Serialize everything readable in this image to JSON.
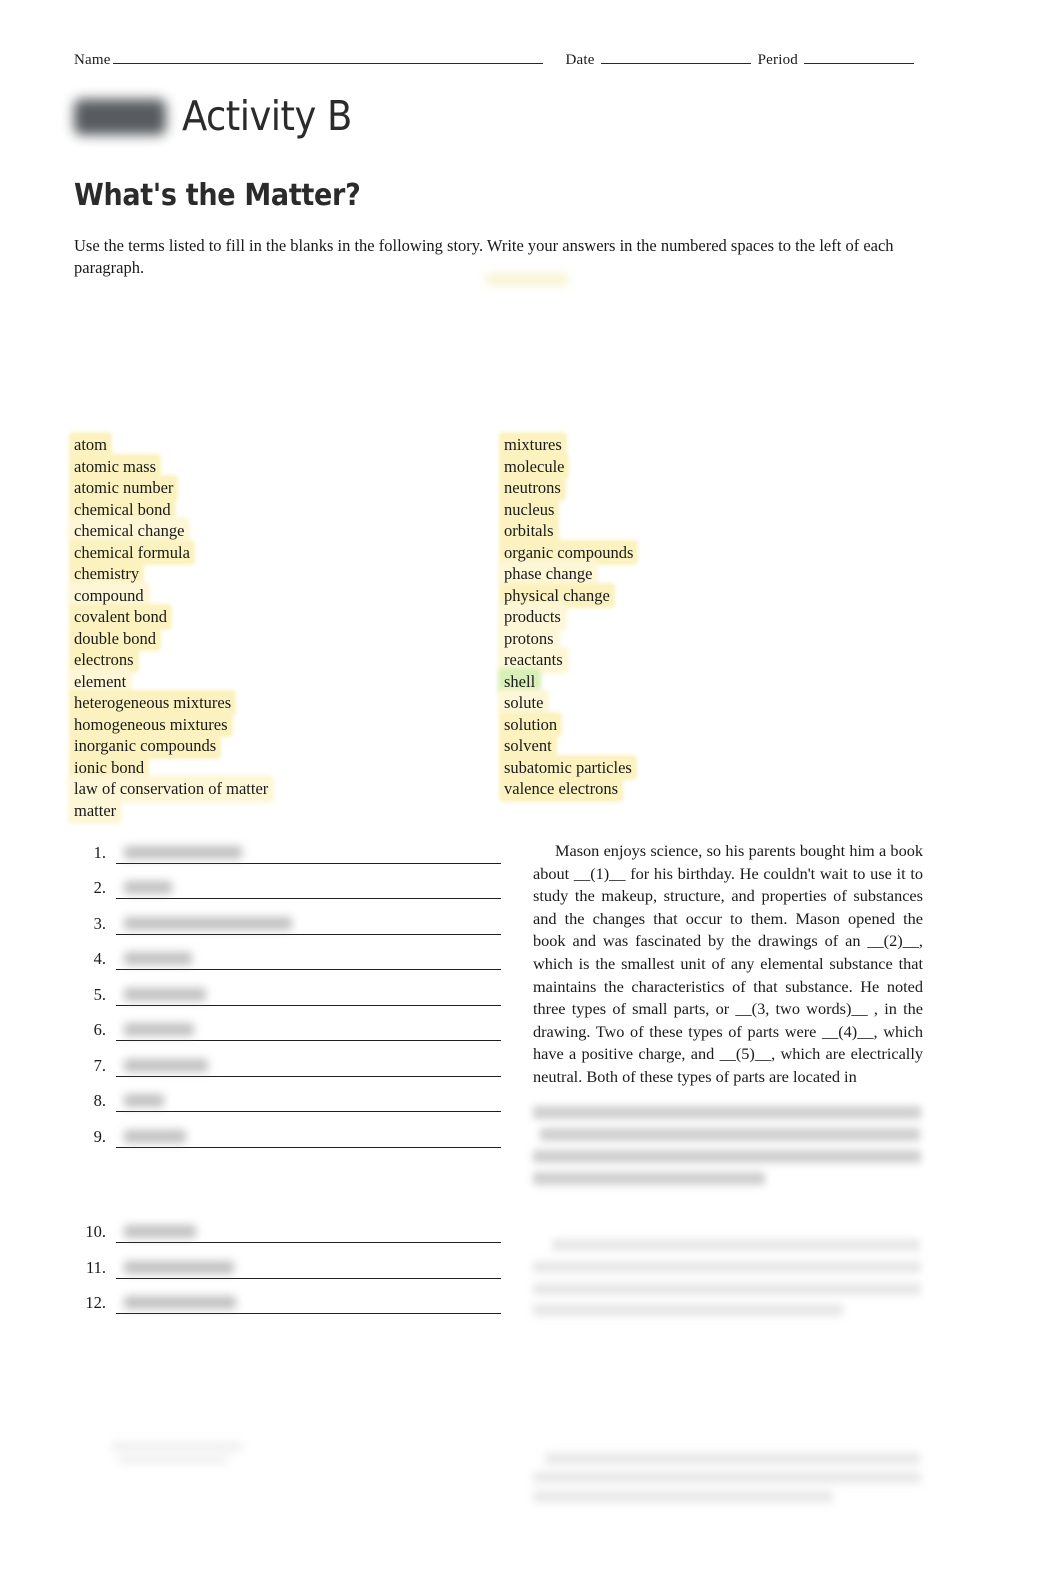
{
  "header": {
    "name_label": "Name",
    "date_label": "Date",
    "period_label": "Period"
  },
  "title": {
    "redacted_label": "",
    "activity": "Activity B",
    "worksheet": "What's the Matter?"
  },
  "instructions": {
    "text": "Use the terms listed to fill in the blanks in the following story. Write your answers in the numbered spaces to the left of each paragraph."
  },
  "word_bank": {
    "left_column": [
      {
        "term": "atom",
        "highlight": "yellow"
      },
      {
        "term": "atomic mass",
        "highlight": "yellow"
      },
      {
        "term": "atomic number",
        "highlight": "yellow"
      },
      {
        "term": "chemical bond",
        "highlight": "yellow"
      },
      {
        "term": "chemical change",
        "highlight": "yellow-soft"
      },
      {
        "term": "chemical formula",
        "highlight": "yellow"
      },
      {
        "term": "chemistry",
        "highlight": "yellow"
      },
      {
        "term": "compound",
        "highlight": "yellow-soft"
      },
      {
        "term": "covalent bond",
        "highlight": "yellow"
      },
      {
        "term": "double bond",
        "highlight": "yellow"
      },
      {
        "term": "electrons",
        "highlight": "yellow"
      },
      {
        "term": "element",
        "highlight": "yellow-soft"
      },
      {
        "term": "heterogeneous mixtures",
        "highlight": "yellow"
      },
      {
        "term": "homogeneous mixtures",
        "highlight": "yellow"
      },
      {
        "term": "inorganic compounds",
        "highlight": "yellow"
      },
      {
        "term": "ionic bond",
        "highlight": "yellow"
      },
      {
        "term": "law of conservation of matter",
        "highlight": "yellow-soft"
      },
      {
        "term": "matter",
        "highlight": "yellow-soft"
      }
    ],
    "right_column": [
      {
        "term": "mixtures",
        "highlight": "yellow"
      },
      {
        "term": "molecule",
        "highlight": "yellow"
      },
      {
        "term": "neutrons",
        "highlight": "yellow"
      },
      {
        "term": "nucleus",
        "highlight": "yellow"
      },
      {
        "term": "orbitals",
        "highlight": "yellow"
      },
      {
        "term": "organic compounds",
        "highlight": "yellow"
      },
      {
        "term": "phase change",
        "highlight": "yellow-soft"
      },
      {
        "term": "physical change",
        "highlight": "yellow"
      },
      {
        "term": "products",
        "highlight": "yellow-soft"
      },
      {
        "term": "protons",
        "highlight": "yellow-soft"
      },
      {
        "term": "reactants",
        "highlight": "yellow-soft"
      },
      {
        "term": "shell",
        "highlight": "green"
      },
      {
        "term": "solute",
        "highlight": "yellow-soft"
      },
      {
        "term": "solution",
        "highlight": "yellow"
      },
      {
        "term": "solvent",
        "highlight": "yellow"
      },
      {
        "term": "subatomic particles",
        "highlight": "yellow"
      },
      {
        "term": "valence electrons",
        "highlight": "yellow"
      }
    ]
  },
  "answers": {
    "items": [
      {
        "number": "1.",
        "answer": "",
        "answer_width": 118,
        "redacted": true
      },
      {
        "number": "2.",
        "answer": "",
        "answer_width": 48,
        "redacted": true
      },
      {
        "number": "3.",
        "answer": "",
        "answer_width": 168,
        "redacted": true
      },
      {
        "number": "4.",
        "answer": "",
        "answer_width": 68,
        "redacted": true
      },
      {
        "number": "5.",
        "answer": "",
        "answer_width": 82,
        "redacted": true
      },
      {
        "number": "6.",
        "answer": "",
        "answer_width": 70,
        "redacted": true
      },
      {
        "number": "7.",
        "answer": "",
        "answer_width": 84,
        "redacted": true
      },
      {
        "number": "8.",
        "answer": "",
        "answer_width": 40,
        "redacted": true
      },
      {
        "number": "9.",
        "answer": "",
        "answer_width": 62,
        "redacted": true
      },
      {
        "number": "10.",
        "answer": "",
        "answer_width": 72,
        "redacted": true
      },
      {
        "number": "11.",
        "answer": "",
        "answer_width": 110,
        "redacted": true
      },
      {
        "number": "12.",
        "answer": "",
        "answer_width": 112,
        "redacted": true
      }
    ]
  },
  "story": {
    "paragraph_1": "Mason enjoys science, so his parents bought him a book about __(1)__ for his birthday. He couldn't wait to use it to study the makeup, structure, and proper­ties of substances and the changes that occur to them. Mason opened the book and was fascinated by the drawings of an __(2)__, which is the smallest unit of any elemental substance that maintains the char­acteristics of that substance. He noted three types of small parts, or __(3, two words)__ , in the drawing. Two of these types of parts were __(4)__, which have a positive charge, and __(5)__, which are electrically neutral. Both of these types of parts are located in",
    "paragraph_2_redacted": "",
    "paragraph_3_redacted": "",
    "paragraph_4_redacted": ""
  }
}
